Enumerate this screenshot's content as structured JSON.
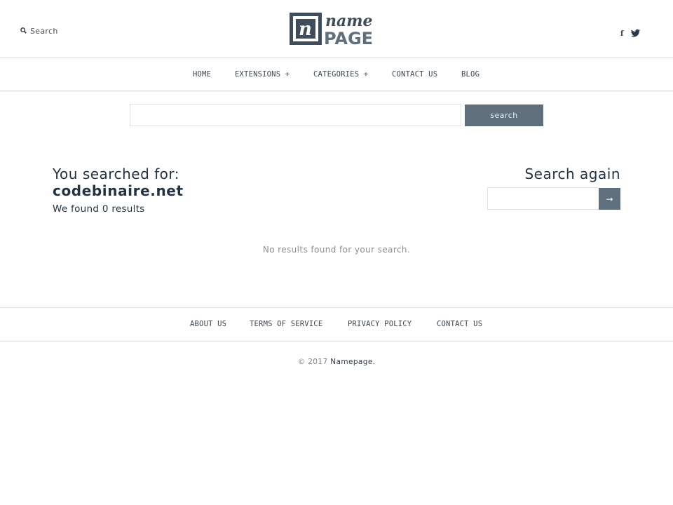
{
  "header": {
    "search_label": "Search",
    "logo_text_top": "name",
    "logo_text_bottom": "PAGE",
    "logo_mark": "n",
    "social_facebook": "f"
  },
  "nav": {
    "items": [
      "HOME",
      "EXTENSIONS +",
      "CATEGORIES +",
      "CONTACT US",
      "BLOG"
    ]
  },
  "top_search": {
    "value": "",
    "button_label": "search"
  },
  "results": {
    "searched_label": "You searched for:",
    "searched_term": "codebinaire.net",
    "found_text": "We found 0 results",
    "empty_message": "No results found for your search."
  },
  "sidebar": {
    "title": "Search again",
    "input_value": "",
    "button_label": "→"
  },
  "footer": {
    "items": [
      "ABOUT US",
      "TERMS OF SERVICE",
      "PRIVACY POLICY",
      "CONTACT US"
    ],
    "copyright_prefix": "© 2017",
    "brand": "Namepage."
  },
  "colors": {
    "accent": "#5f6f7c",
    "text": "#243344",
    "border": "#dcdcdc"
  },
  "icons": {
    "header_search": "search-icon",
    "facebook": "facebook-icon",
    "twitter": "twitter-icon"
  }
}
